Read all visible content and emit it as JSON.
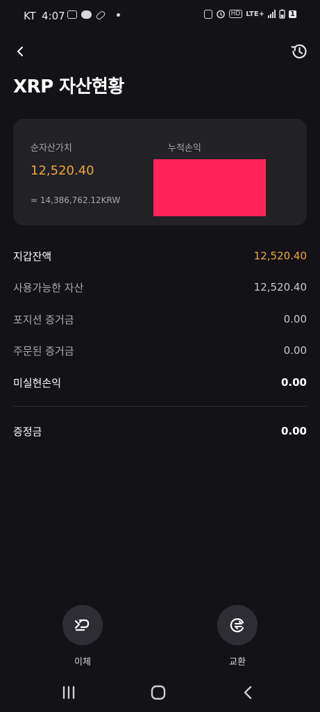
{
  "status_bar": {
    "carrier": "KT",
    "time": "4:07",
    "network": "LTE+",
    "hd_label": "HD",
    "battery_badge": "1"
  },
  "header": {
    "title": "XRP 자산현황"
  },
  "summary": {
    "net_asset_label": "순자산가치",
    "net_asset_value": "12,520.40",
    "net_asset_krw": "≈ 14,386,762.12KRW",
    "cumulative_pnl_label": "누적손익"
  },
  "rows": [
    {
      "label": "지갑잔액",
      "value": "12,520.40"
    },
    {
      "label": "사용가능한 자산",
      "value": "12,520.40"
    },
    {
      "label": "포지션 증거금",
      "value": "0.00"
    },
    {
      "label": "주문된 증거금",
      "value": "0.00"
    },
    {
      "label": "미실현손익",
      "value": "0.00"
    },
    {
      "label": "증정금",
      "value": "0.00"
    }
  ],
  "actions": {
    "transfer_label": "이체",
    "exchange_label": "교환"
  },
  "colors": {
    "background": "#131317",
    "card": "#212126",
    "accent": "#f0a63a",
    "redaction": "#ff2458"
  }
}
